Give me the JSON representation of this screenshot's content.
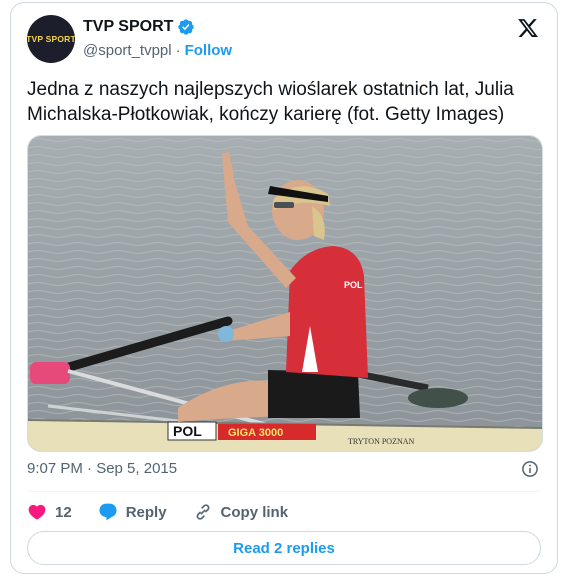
{
  "author": {
    "avatar_text": "TVP SPORT",
    "name": "TVP SPORT",
    "handle": "@sport_tvppl",
    "separator": "·",
    "follow_label": "Follow"
  },
  "tweet": {
    "text": "Jedna z naszych najlepszych wioślarek ostatnich lat, Julia Michalska-Płotkowiak, kończy karierę (fot. Getty Images)",
    "photo_texts": {
      "boat_code": "POL",
      "sponsor": "GIGA 3000",
      "boat_maker": "TRYTON POZNAN",
      "shirt": "POL"
    },
    "timestamp": "9:07 PM · Sep 5, 2015"
  },
  "actions": {
    "like_count": "12",
    "reply_label": "Reply",
    "copy_label": "Copy link"
  },
  "read_replies_label": "Read 2 replies",
  "colors": {
    "accent": "#1d9bf0",
    "like": "#f91880",
    "text": "#0f1419",
    "secondary": "#536471"
  }
}
